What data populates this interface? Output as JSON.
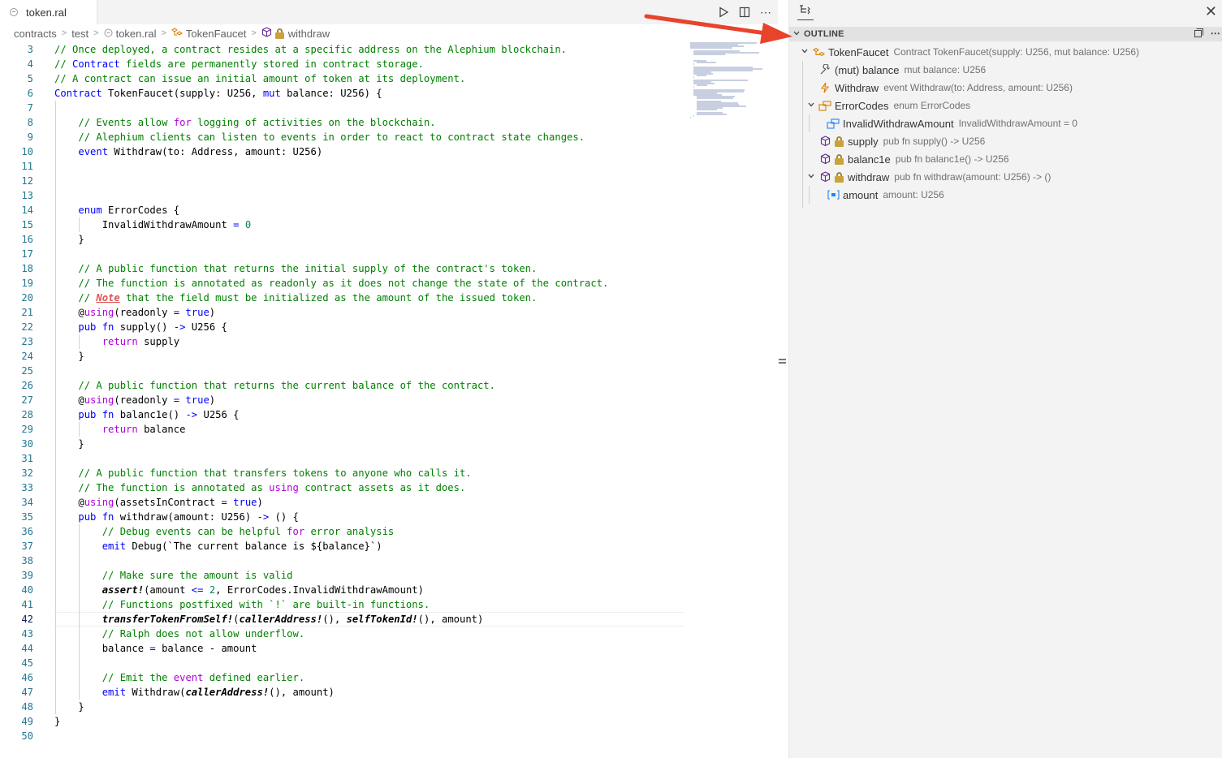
{
  "editor": {
    "tab": {
      "label": "token.ral"
    },
    "breadcrumbs": [
      "contracts",
      "test",
      "token.ral",
      "TokenFaucet",
      "withdraw"
    ],
    "current_line": 42,
    "lines": [
      {
        "n": "3",
        "t": "// Once deployed, a contract resides at a specific address on the Alephium blockchain."
      },
      {
        "n": "4",
        "t": "// Contract fields are permanently stored in contract storage."
      },
      {
        "n": "5",
        "t": "// A contract can issue an initial amount of token at its deployment."
      },
      {
        "n": "6",
        "t": "Contract TokenFaucet(supply: U256, mut balance: U256) {"
      },
      {
        "n": "7",
        "t": ""
      },
      {
        "n": "8",
        "t": "    // Events allow for logging of activities on the blockchain."
      },
      {
        "n": "9",
        "t": "    // Alephium clients can listen to events in order to react to contract state changes."
      },
      {
        "n": "10",
        "t": "    event Withdraw(to: Address, amount: U256)"
      },
      {
        "n": "11",
        "t": ""
      },
      {
        "n": "12",
        "t": ""
      },
      {
        "n": "13",
        "t": ""
      },
      {
        "n": "14",
        "t": "    enum ErrorCodes {"
      },
      {
        "n": "15",
        "t": "        InvalidWithdrawAmount = 0"
      },
      {
        "n": "16",
        "t": "    }"
      },
      {
        "n": "17",
        "t": ""
      },
      {
        "n": "18",
        "t": "    // A public function that returns the initial supply of the contract's token."
      },
      {
        "n": "19",
        "t": "    // The function is annotated as readonly as it does not change the state of the contract."
      },
      {
        "n": "20",
        "t": "    // Note that the field must be initialized as the amount of the issued token."
      },
      {
        "n": "21",
        "t": "    @using(readonly = true)"
      },
      {
        "n": "22",
        "t": "    pub fn supply() -> U256 {"
      },
      {
        "n": "23",
        "t": "        return supply"
      },
      {
        "n": "24",
        "t": "    }"
      },
      {
        "n": "25",
        "t": ""
      },
      {
        "n": "26",
        "t": "    // A public function that returns the current balance of the contract."
      },
      {
        "n": "27",
        "t": "    @using(readonly = true)"
      },
      {
        "n": "28",
        "t": "    pub fn balanc1e() -> U256 {"
      },
      {
        "n": "29",
        "t": "        return balance"
      },
      {
        "n": "30",
        "t": "    }"
      },
      {
        "n": "31",
        "t": ""
      },
      {
        "n": "32",
        "t": "    // A public function that transfers tokens to anyone who calls it."
      },
      {
        "n": "33",
        "t": "    // The function is annotated as using contract assets as it does."
      },
      {
        "n": "34",
        "t": "    @using(assetsInContract = true)"
      },
      {
        "n": "35",
        "t": "    pub fn withdraw(amount: U256) -> () {"
      },
      {
        "n": "36",
        "t": "        // Debug events can be helpful for error analysis"
      },
      {
        "n": "37",
        "t": "        emit Debug(`The current balance is ${balance}`)"
      },
      {
        "n": "38",
        "t": ""
      },
      {
        "n": "39",
        "t": "        // Make sure the amount is valid"
      },
      {
        "n": "40",
        "t": "        assert!(amount <= 2, ErrorCodes.InvalidWithdrawAmount)"
      },
      {
        "n": "41",
        "t": "        // Functions postfixed with `!` are built-in functions."
      },
      {
        "n": "42",
        "t": "        transferTokenFromSelf!(callerAddress!(), selfTokenId!(), amount)"
      },
      {
        "n": "43",
        "t": "        // Ralph does not allow underflow."
      },
      {
        "n": "44",
        "t": "        balance = balance - amount"
      },
      {
        "n": "45",
        "t": ""
      },
      {
        "n": "46",
        "t": "        // Emit the event defined earlier."
      },
      {
        "n": "47",
        "t": "        emit Withdraw(callerAddress!(), amount)"
      },
      {
        "n": "48",
        "t": "    }"
      },
      {
        "n": "49",
        "t": "}"
      },
      {
        "n": "50",
        "t": ""
      }
    ]
  },
  "outline": {
    "title": "OUTLINE",
    "items": [
      {
        "label": "TokenFaucet",
        "detail": "Contract TokenFaucet(supply: U256, mut balance: U256)",
        "icon": "class-icon",
        "depth": 0,
        "expanded": true,
        "lock": false
      },
      {
        "label": "(mut) balance",
        "detail": "mut balance: U256",
        "icon": "wrench-field-icon",
        "depth": 1,
        "expanded": null,
        "lock": false
      },
      {
        "label": "Withdraw",
        "detail": "event Withdraw(to: Address, amount: U256)",
        "icon": "event-bolt-icon",
        "depth": 1,
        "expanded": null,
        "lock": false
      },
      {
        "label": "ErrorCodes",
        "detail": "enum ErrorCodes",
        "icon": "enum-icon",
        "depth": 1,
        "expanded": true,
        "lock": false
      },
      {
        "label": "InvalidWithdrawAmount",
        "detail": "InvalidWithdrawAmount = 0",
        "icon": "enum-member-icon",
        "depth": 2,
        "expanded": null,
        "lock": false
      },
      {
        "label": "supply",
        "detail": "pub fn supply() -> U256",
        "icon": "method-cube-icon",
        "depth": 1,
        "expanded": null,
        "lock": true
      },
      {
        "label": "balanc1e",
        "detail": "pub fn balanc1e() -> U256",
        "icon": "method-cube-icon",
        "depth": 1,
        "expanded": null,
        "lock": true
      },
      {
        "label": "withdraw",
        "detail": "pub fn withdraw(amount: U256) -> ()",
        "icon": "method-cube-icon",
        "depth": 1,
        "expanded": true,
        "lock": true
      },
      {
        "label": "amount",
        "detail": "amount: U256",
        "icon": "variable-icon",
        "depth": 2,
        "expanded": null,
        "lock": false
      }
    ]
  },
  "colors": {
    "comment": "#008000",
    "keyword": "#0000ff",
    "control": "#af00db",
    "number": "#098658",
    "linenumber": "#237893",
    "arrow": "#e8432b",
    "method_icon": "#652d90",
    "class_icon": "#d67e00"
  }
}
